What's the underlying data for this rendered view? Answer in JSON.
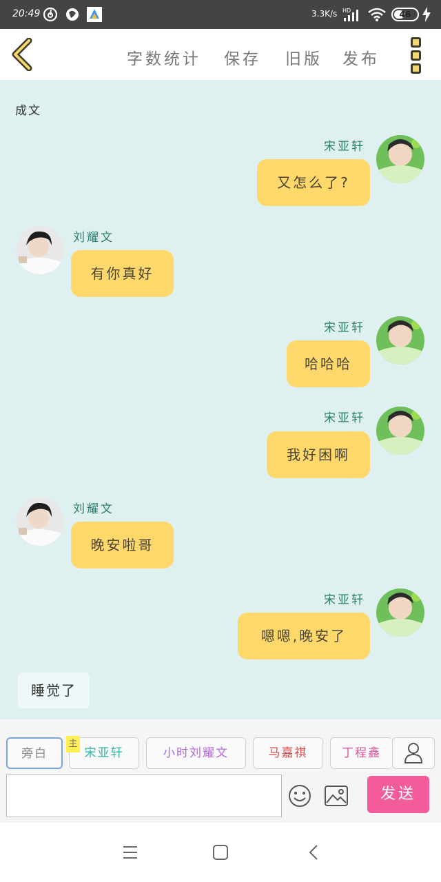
{
  "status_bar": {
    "time": "20:49",
    "network_speed": "3.3K/s",
    "network_type": "HD",
    "battery_level": "46",
    "battery_fraction": 0.46
  },
  "toolbar": {
    "actions": [
      "字数统计",
      "保存",
      "旧版",
      "发布"
    ]
  },
  "chat": {
    "title": "成文",
    "messages": [
      {
        "side": "right",
        "name": "宋亚轩",
        "text": "又怎么了?",
        "avatar": "avatar-song-yaxuan"
      },
      {
        "side": "left",
        "name": "刘耀文",
        "text": "有你真好",
        "avatar": "avatar-liu-yaowen"
      },
      {
        "side": "right",
        "name": "宋亚轩",
        "text": "哈哈哈",
        "avatar": "avatar-song-yaxuan"
      },
      {
        "side": "right",
        "name": "宋亚轩",
        "text": "我好困啊",
        "avatar": "avatar-song-yaxuan"
      },
      {
        "side": "left",
        "name": "刘耀文",
        "text": "晚安啦哥",
        "avatar": "avatar-liu-yaowen"
      },
      {
        "side": "right",
        "name": "宋亚轩",
        "text": "嗯嗯,晚安了",
        "avatar": "avatar-song-yaxuan"
      }
    ],
    "narration": "睡觉了"
  },
  "input_panel": {
    "roles": [
      {
        "label": "旁白",
        "color": "#888888"
      },
      {
        "label": "宋亚轩",
        "color": "#2bb3a3"
      },
      {
        "label": "小时刘耀文",
        "color": "#b06ad8"
      },
      {
        "label": "马嘉祺",
        "color": "#d84a4a"
      },
      {
        "label": "丁程鑫",
        "color": "#e0559a"
      }
    ],
    "main_tag": "主",
    "input_value": "",
    "send_label": "发送"
  },
  "colors": {
    "bubble": "#ffd86b",
    "chat_background": "#dff0f0",
    "send_button": "#f45b9a",
    "name_color": "#2b7d6a"
  },
  "nav_bar": {
    "icons": [
      "menu-icon",
      "home-square-icon",
      "back-triangle-icon"
    ]
  }
}
